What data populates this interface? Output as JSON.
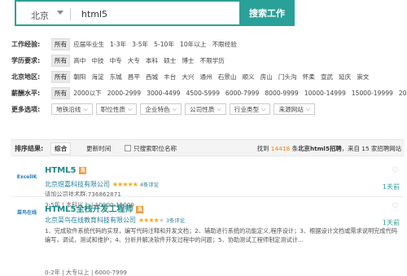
{
  "search": {
    "city": "北京",
    "query": "html5",
    "button": "搜索工作"
  },
  "filters": {
    "work_exp": {
      "label": "工作经验:",
      "options": [
        "所有",
        "应届毕业生",
        "1-3年",
        "3-5年",
        "5-10年",
        "10年以上",
        "不限经验"
      ]
    },
    "education": {
      "label": "学历要求:",
      "options": [
        "所有",
        "高中",
        "中技",
        "中专",
        "大专",
        "本科",
        "硕士",
        "博士",
        "不限学历"
      ]
    },
    "district": {
      "label": "北京地区:",
      "options": [
        "所有",
        "朝阳",
        "海淀",
        "东城",
        "昌平",
        "西城",
        "丰台",
        "大兴",
        "通州",
        "石景山",
        "顺义",
        "房山",
        "门头沟",
        "怀柔",
        "宣武",
        "延庆",
        "崇文"
      ]
    },
    "salary": {
      "label": "薪酬水平:",
      "options": [
        "所有",
        "2000以下",
        "2000-2999",
        "3000-4499",
        "4500-5999",
        "6000-7999",
        "8000-9999",
        "10000-14999",
        "15000-19999",
        "20000-"
      ]
    },
    "more": {
      "label": "更多选项:",
      "dropdowns": [
        "地铁沿线",
        "职位性质",
        "企业特色",
        "公司性质",
        "行业类型",
        "来源网站"
      ]
    }
  },
  "sortbar": {
    "label": "排序结果:",
    "sort_default": "综合",
    "sort_time": "更新时间",
    "only_title": "只搜索职位名称",
    "result_prefix": "找到",
    "result_count": "14418",
    "result_mid": "条",
    "result_query": "北京html5招聘",
    "result_suffix": "，来自 15 家招聘网站"
  },
  "jobs": [
    {
      "logo": "ExcelIK",
      "title": "HTML5",
      "hot_badge": "急",
      "company": "北京煜嘉科技有限公司",
      "stars": "★★★★★",
      "stars_off": "",
      "reviews": "4条评论",
      "contact": "请加公司技术群:736862871",
      "meta": "3-5年 | 本科以上 | 10000-15000",
      "posted": "1天前"
    },
    {
      "logo": "菜鸟在线",
      "title": "HTML5全栈开发工程师",
      "hot_badge": "急",
      "company": "北京菜鸟在线教育科技有限公司",
      "stars": "★★★★",
      "stars_off": "★",
      "reviews": "3条评论",
      "desc": "1、完成软件系统代码的实现，编写代码注释和开发文档；2、辅助进行系统的功能定义,程序设计；3、根据设计文档或需求说明完成代码编写，调试，测试和维护；4、分析并解决软件开发过程中的问题；5、协助测试工程师制定测试计...",
      "meta": "0-2年 | 大专以上 | 6000-7999",
      "posted": "1天前"
    }
  ],
  "colors": {
    "accent": "#2aa198",
    "orange": "#ff7a00",
    "star": "#ffa800"
  }
}
